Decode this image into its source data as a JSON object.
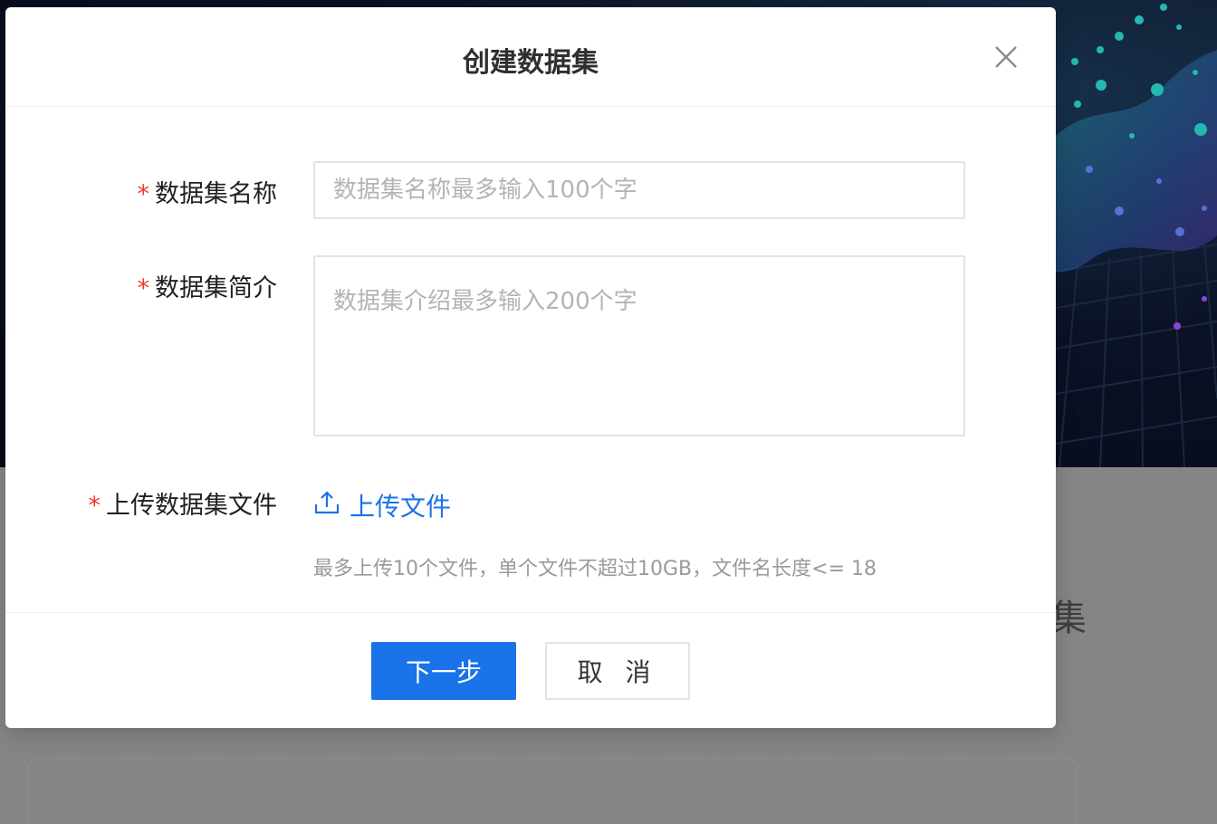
{
  "background": {
    "partial_title": "集"
  },
  "modal": {
    "title": "创建数据集",
    "fields": {
      "name": {
        "required_mark": "*",
        "label": "数据集名称",
        "placeholder": "数据集名称最多输入100个字",
        "value": ""
      },
      "description": {
        "required_mark": "*",
        "label": "数据集简介",
        "placeholder": "数据集介绍最多输入200个字",
        "value": ""
      },
      "upload": {
        "required_mark": "*",
        "label": "上传数据集文件",
        "link_label": "上传文件",
        "icon": "upload-icon",
        "hint": "最多上传10个文件，单个文件不超过10GB，文件名长度<= 18"
      }
    },
    "footer": {
      "next_label": "下一步",
      "cancel_label": "取 消"
    },
    "close_icon": "close-icon"
  },
  "colors": {
    "primary": "#1a73e8",
    "required": "#f0392b",
    "placeholder": "#b4b4b4",
    "hint": "#9a9a9a",
    "overlay": "#7f7f7f"
  }
}
